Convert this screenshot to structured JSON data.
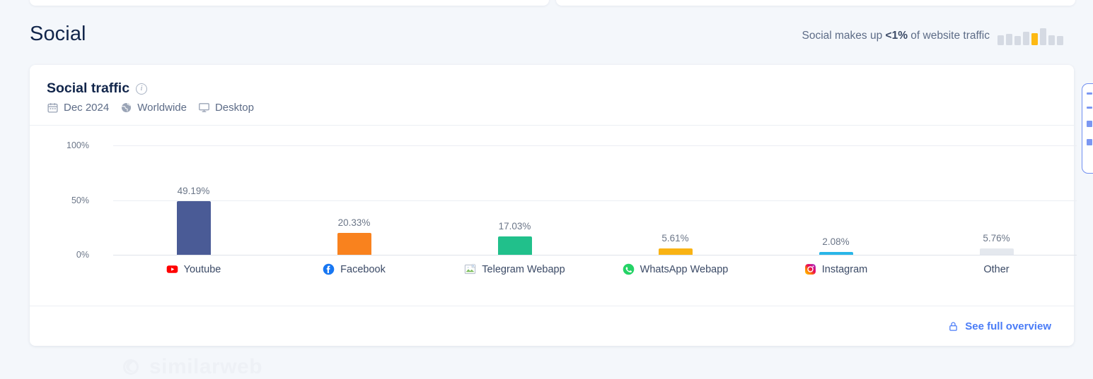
{
  "page_title": "Social",
  "traffic_summary": {
    "prefix": "Social makes up ",
    "value": "<1%",
    "suffix": " of website traffic",
    "mini_bars": [
      {
        "height": 14,
        "color": "#d5dae3"
      },
      {
        "height": 16,
        "color": "#d5dae3"
      },
      {
        "height": 13,
        "color": "#d5dae3"
      },
      {
        "height": 19,
        "color": "#d5dae3"
      },
      {
        "height": 17,
        "color": "#fdb913"
      },
      {
        "height": 24,
        "color": "#d5dae3"
      },
      {
        "height": 14,
        "color": "#d5dae3"
      },
      {
        "height": 13,
        "color": "#d5dae3"
      }
    ]
  },
  "card": {
    "title": "Social traffic",
    "info_glyph": "i",
    "meta": [
      {
        "icon": "calendar-icon",
        "label": "Dec 2024"
      },
      {
        "icon": "globe-icon",
        "label": "Worldwide"
      },
      {
        "icon": "desktop-icon",
        "label": "Desktop"
      }
    ],
    "watermark": "similarweb",
    "footer_link": "See full overview",
    "footer_icon": "lock-icon"
  },
  "chart_data": {
    "type": "bar",
    "title": "Social traffic",
    "xlabel": "",
    "ylabel": "",
    "ylim": [
      0,
      100
    ],
    "yticks": [
      "100%",
      "50%",
      "0%"
    ],
    "ytick_values": [
      100,
      50,
      0
    ],
    "grid": true,
    "legend": "none",
    "categories": [
      "Youtube",
      "Facebook",
      "Telegram Webapp",
      "WhatsApp Webapp",
      "Instagram",
      "Other"
    ],
    "values": [
      49.19,
      20.33,
      17.03,
      5.61,
      2.08,
      5.76
    ],
    "value_labels": [
      "49.19%",
      "20.33%",
      "17.03%",
      "5.61%",
      "2.08%",
      "5.76%"
    ],
    "bar_colors": [
      "#4a5b96",
      "#f9821e",
      "#21c08b",
      "#f9b314",
      "#29b6e8",
      "#e4e8ee"
    ],
    "category_icons": [
      "youtube-icon",
      "facebook-icon",
      "broken-image-icon",
      "whatsapp-icon",
      "instagram-icon",
      "no-icon"
    ]
  }
}
